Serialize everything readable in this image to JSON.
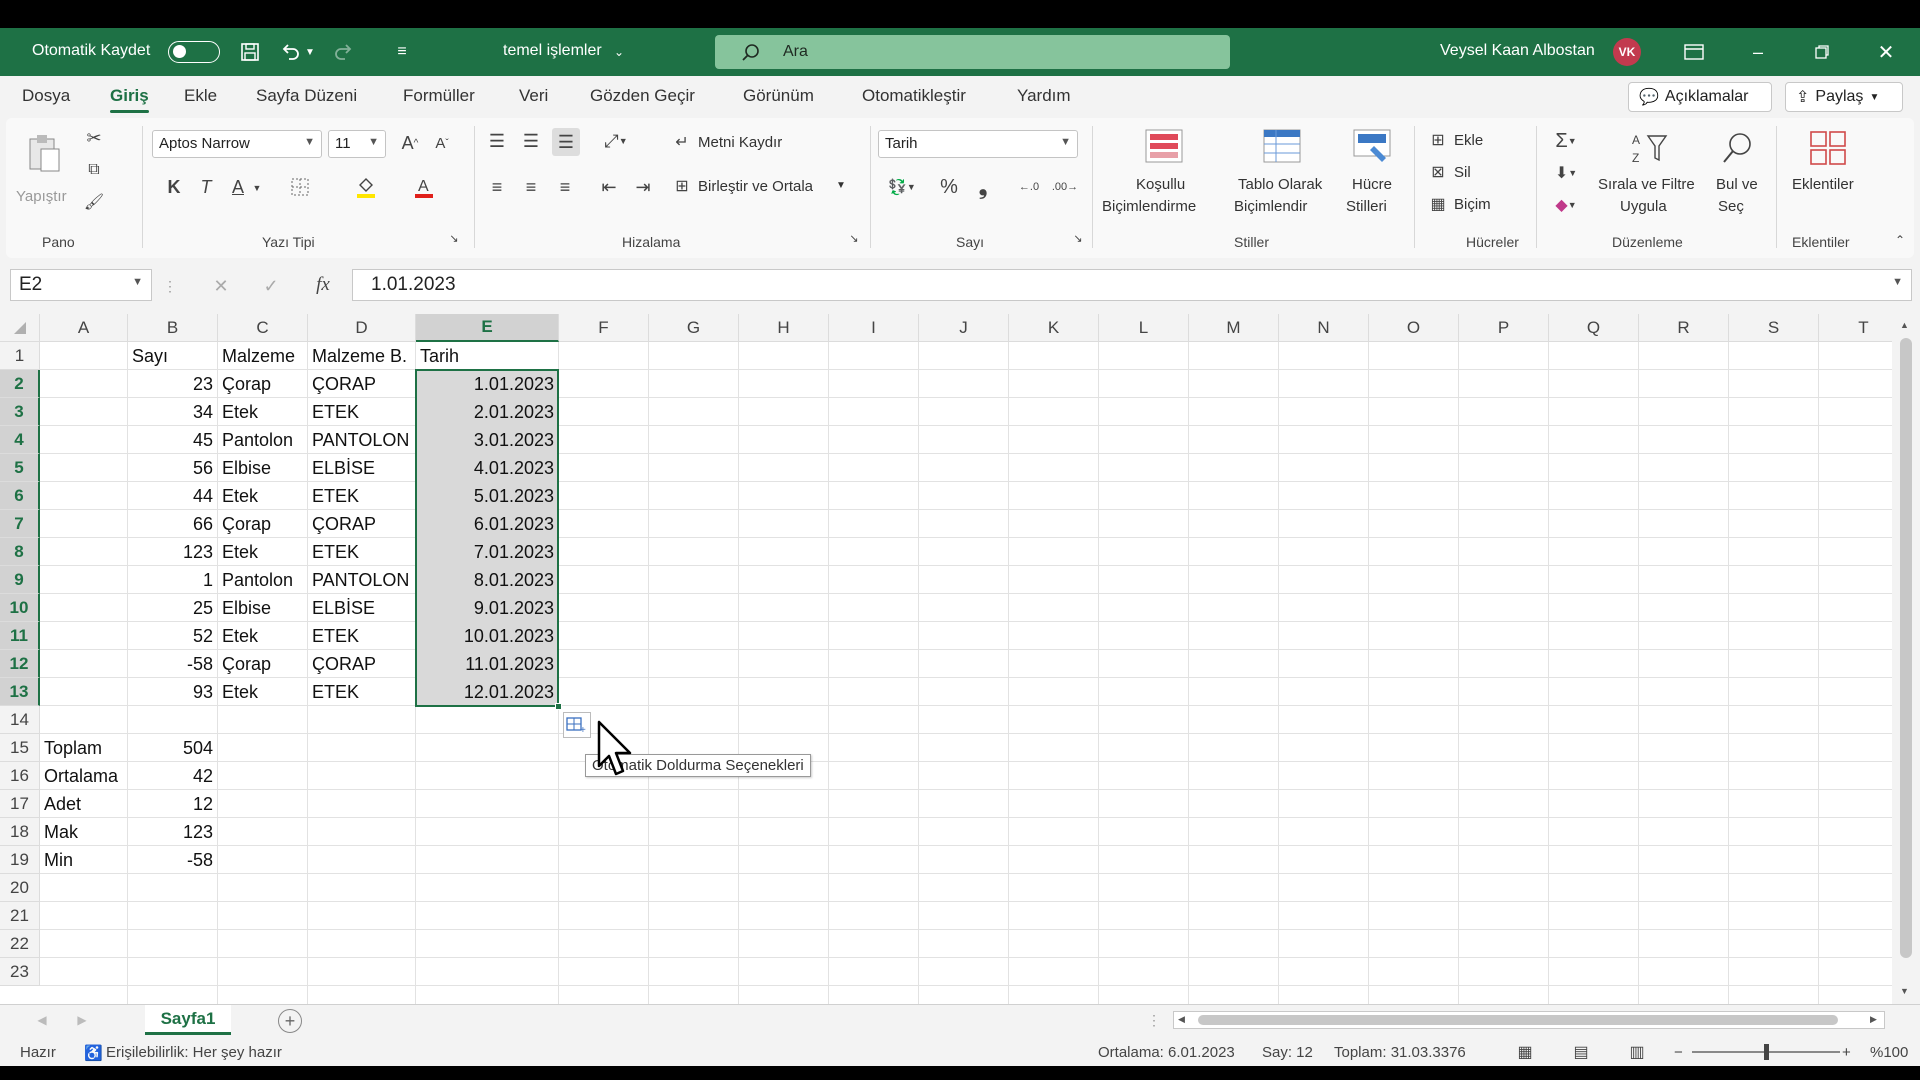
{
  "titlebar": {
    "autosave_label": "Otomatik Kaydet",
    "document_title": "temel işlemler",
    "search_placeholder": "Ara",
    "user_name": "Veysel Kaan Albostan",
    "user_initials": "VK"
  },
  "menu": {
    "tabs": [
      "Dosya",
      "Giriş",
      "Ekle",
      "Sayfa Düzeni",
      "Formüller",
      "Veri",
      "Gözden Geçir",
      "Görünüm",
      "Otomatikleştir",
      "Yardım"
    ],
    "active_tab": "Giriş",
    "comments_button": "Açıklamalar",
    "share_button": "Paylaş"
  },
  "ribbon": {
    "clipboard": {
      "paste": "Yapıştır",
      "group": "Pano"
    },
    "font": {
      "name": "Aptos Narrow",
      "size": "11",
      "bold": "K",
      "italic": "T",
      "underline": "A",
      "group": "Yazı Tipi"
    },
    "alignment": {
      "wrap": "Metni Kaydır",
      "merge": "Birleştir ve Ortala",
      "group": "Hizalama"
    },
    "number": {
      "format": "Tarih",
      "percent": "%",
      "comma": "❟",
      "group": "Sayı"
    },
    "styles": {
      "conditional_1": "Koşullu",
      "conditional_2": "Biçimlendirme",
      "table_1": "Tablo Olarak",
      "table_2": "Biçimlendir",
      "cell_1": "Hücre",
      "cell_2": "Stilleri",
      "group": "Stiller"
    },
    "cells": {
      "insert": "Ekle",
      "delete": "Sil",
      "format": "Biçim",
      "group": "Hücreler"
    },
    "editing": {
      "sort_1": "Sırala ve Filtre",
      "sort_2": "Uygula",
      "find_1": "Bul ve",
      "find_2": "Seç",
      "group": "Düzenleme"
    },
    "addins": {
      "label": "Eklentiler",
      "group": "Eklentiler"
    }
  },
  "formula_bar": {
    "name_box": "E2",
    "fx": "fx",
    "formula": "1.01.2023"
  },
  "grid": {
    "columns": [
      "A",
      "B",
      "C",
      "D",
      "E",
      "F",
      "G",
      "H",
      "I",
      "J",
      "K",
      "L",
      "M",
      "N",
      "O",
      "P",
      "Q",
      "R",
      "S",
      "T"
    ],
    "rows": [
      "1",
      "2",
      "3",
      "4",
      "5",
      "6",
      "7",
      "8",
      "9",
      "10",
      "11",
      "12",
      "13",
      "14",
      "15",
      "16",
      "17",
      "18",
      "19",
      "20",
      "21",
      "22",
      "23"
    ],
    "selected_column": "E",
    "selected_rows": [
      "2",
      "3",
      "4",
      "5",
      "6",
      "7",
      "8",
      "9",
      "10",
      "11",
      "12",
      "13"
    ],
    "header_row": {
      "B": "Sayı",
      "C": "Malzeme",
      "D": "Malzeme B.",
      "E": "Tarih"
    },
    "data_rows": [
      {
        "B": "23",
        "C": "Çorap",
        "D": "ÇORAP",
        "E": "1.01.2023"
      },
      {
        "B": "34",
        "C": "Etek",
        "D": "ETEK",
        "E": "2.01.2023"
      },
      {
        "B": "45",
        "C": "Pantolon",
        "D": "PANTOLON",
        "E": "3.01.2023"
      },
      {
        "B": "56",
        "C": "Elbise",
        "D": "ELBİSE",
        "E": "4.01.2023"
      },
      {
        "B": "44",
        "C": "Etek",
        "D": "ETEK",
        "E": "5.01.2023"
      },
      {
        "B": "66",
        "C": "Çorap",
        "D": "ÇORAP",
        "E": "6.01.2023"
      },
      {
        "B": "123",
        "C": "Etek",
        "D": "ETEK",
        "E": "7.01.2023"
      },
      {
        "B": "1",
        "C": "Pantolon",
        "D": "PANTOLON",
        "E": "8.01.2023"
      },
      {
        "B": "25",
        "C": "Elbise",
        "D": "ELBİSE",
        "E": "9.01.2023"
      },
      {
        "B": "52",
        "C": "Etek",
        "D": "ETEK",
        "E": "10.01.2023"
      },
      {
        "B": "-58",
        "C": "Çorap",
        "D": "ÇORAP",
        "E": "11.01.2023"
      },
      {
        "B": "93",
        "C": "Etek",
        "D": "ETEK",
        "E": "12.01.2023"
      }
    ],
    "summary_rows": [
      {
        "A": "Toplam",
        "B": "504"
      },
      {
        "A": "Ortalama",
        "B": "42"
      },
      {
        "A": "Adet",
        "B": "12"
      },
      {
        "A": "Mak",
        "B": "123"
      },
      {
        "A": "Min",
        "B": "-58"
      }
    ],
    "autofill_tooltip": "Otomatik Doldurma Seçenekleri"
  },
  "sheet_tabs": {
    "active": "Sayfa1"
  },
  "status_bar": {
    "ready": "Hazır",
    "accessibility": "Erişilebilirlik: Her şey hazır",
    "average": "Ortalama: 6.01.2023",
    "count": "Say: 12",
    "sum": "Toplam: 31.03.3376",
    "zoom": "%100"
  },
  "colors": {
    "brand": "#1e7145",
    "search_bg": "#86c49c",
    "avatar": "#c23a4e",
    "selection_fill": "#d9d9d9"
  }
}
